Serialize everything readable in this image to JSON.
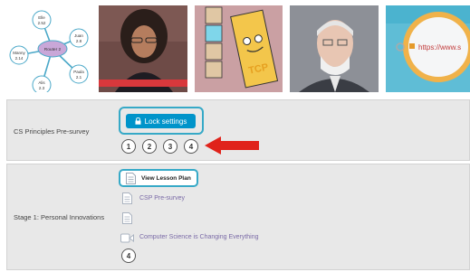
{
  "diagram": {
    "center_node": "Router 2",
    "nodes": [
      {
        "name": "Elle",
        "value": "2.52"
      },
      {
        "name": "Juan",
        "value": "2.8"
      },
      {
        "name": "Manny",
        "value": "2.14"
      },
      {
        "name": "Paula",
        "value": "2.1"
      },
      {
        "name": "Alis",
        "value": "2.3"
      }
    ]
  },
  "thumbnails": {
    "tcp_tile_text": "TCP",
    "browser_url": "https://www.s"
  },
  "rows": [
    {
      "label": "CS Principles Pre-survey",
      "lock_button": "Lock settings",
      "bubbles": [
        "1",
        "2",
        "3",
        "4"
      ]
    },
    {
      "label": "Stage 1: Personal Innovations",
      "lesson_plan": "View Lesson Plan",
      "levels": [
        "CSP Pre-survey",
        "Computer Science is Changing Everything"
      ],
      "bubble": "4"
    }
  ],
  "colors": {
    "accent": "#0094ca",
    "highlight": "#36a9c7",
    "arrow": "#e0231b",
    "link": "#7a6aa6",
    "row_bg": "#e8e8e8"
  },
  "icons": [
    "lock-icon",
    "document-icon",
    "video-icon",
    "red-arrow-icon"
  ]
}
